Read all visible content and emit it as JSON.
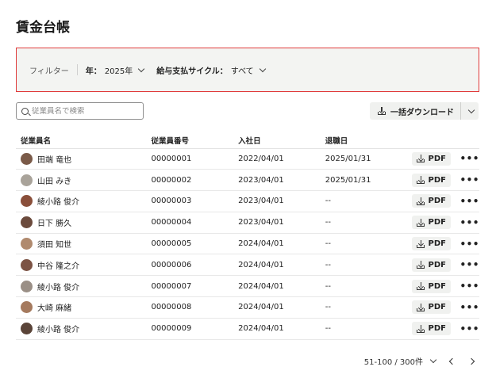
{
  "page": {
    "title": "賃金台帳"
  },
  "filters": {
    "label": "フィルター",
    "year": {
      "key": "年：",
      "value": "2025年"
    },
    "cycle": {
      "key": "給与支払サイクル：",
      "value": "すべて"
    }
  },
  "search": {
    "placeholder": "従業員名で検索",
    "value": ""
  },
  "bulk_download": {
    "label": "一括ダウンロード"
  },
  "table": {
    "headers": [
      "従業員名",
      "従業員番号",
      "入社日",
      "退職日"
    ],
    "pdf_label": "PDF",
    "more_label": "•••",
    "rows": [
      {
        "name": "田端 竜也",
        "id": "00000001",
        "hired": "2022/04/01",
        "retired": "2025/01/31",
        "avatar": "#7a5a48"
      },
      {
        "name": "山田 みき",
        "id": "00000002",
        "hired": "2023/04/01",
        "retired": "2025/01/31",
        "avatar": "#a9a39a"
      },
      {
        "name": "綾小路 俊介",
        "id": "00000003",
        "hired": "2023/04/01",
        "retired": "--",
        "avatar": "#8a4f3a"
      },
      {
        "name": "日下 勝久",
        "id": "00000004",
        "hired": "2023/04/01",
        "retired": "--",
        "avatar": "#6b4a3c"
      },
      {
        "name": "須田 知世",
        "id": "00000005",
        "hired": "2024/04/01",
        "retired": "--",
        "avatar": "#b08a6e"
      },
      {
        "name": "中谷 隆之介",
        "id": "00000006",
        "hired": "2024/04/01",
        "retired": "--",
        "avatar": "#7c5344"
      },
      {
        "name": "綾小路 俊介",
        "id": "00000007",
        "hired": "2024/04/01",
        "retired": "--",
        "avatar": "#9a8f86"
      },
      {
        "name": "大崎 麻緒",
        "id": "00000008",
        "hired": "2024/04/01",
        "retired": "--",
        "avatar": "#a57a5e"
      },
      {
        "name": "綾小路 俊介",
        "id": "00000009",
        "hired": "2024/04/01",
        "retired": "--",
        "avatar": "#5a4438"
      }
    ]
  },
  "pagination": {
    "range": "51-100 / 300件"
  },
  "colors": {
    "filter_border": "#e03a3a",
    "filter_bg": "#f3f4f2",
    "button_bg": "#f0f1ef"
  }
}
